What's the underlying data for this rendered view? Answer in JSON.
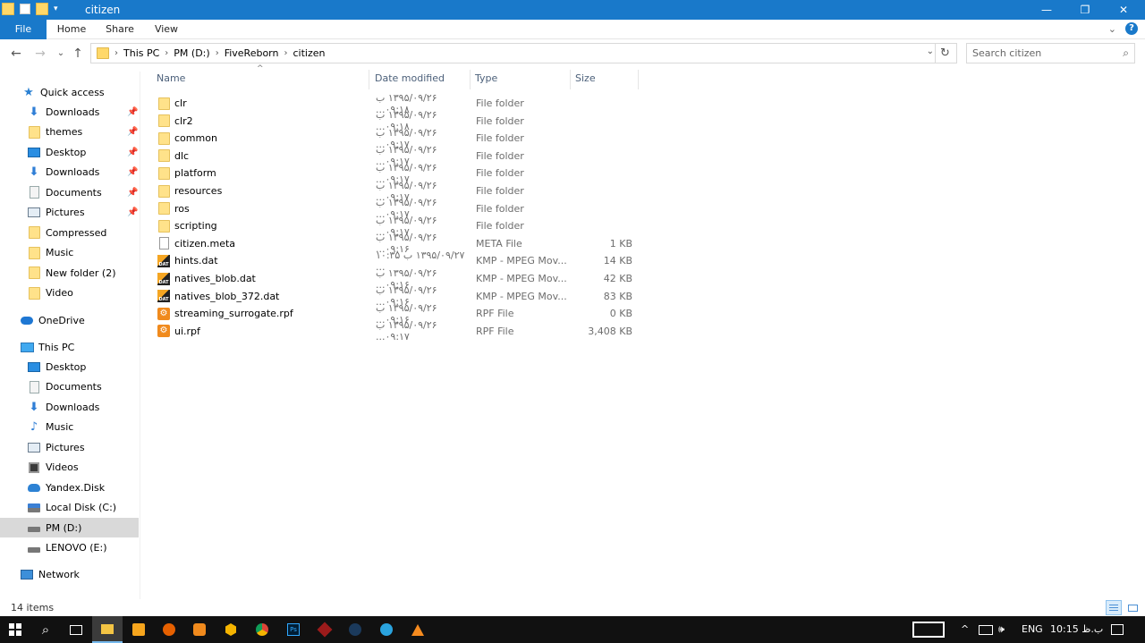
{
  "window": {
    "title": "citizen",
    "controls": {
      "minimize": "—",
      "restore": "❐",
      "close": "✕"
    }
  },
  "ribbon": {
    "tabs": [
      "File",
      "Home",
      "Share",
      "View"
    ],
    "help": "?",
    "expand": "⌄"
  },
  "navigation": {
    "back": "←",
    "forward": "→",
    "recent": "⌄",
    "up": "↑",
    "breadcrumbs": [
      "This PC",
      "PM (D:)",
      "FiveReborn",
      "citizen"
    ],
    "refresh": "↻",
    "dropdown": "⌄",
    "separator": "›"
  },
  "search": {
    "placeholder": "Search citizen"
  },
  "sidebar": {
    "quick_access": "Quick access",
    "quick_items": [
      {
        "label": "Downloads",
        "icon": "downloads-icon",
        "pinned": true
      },
      {
        "label": "themes",
        "icon": "folder-icon",
        "pinned": true
      },
      {
        "label": "Desktop",
        "icon": "desktop-icon",
        "pinned": true
      },
      {
        "label": "Downloads",
        "icon": "downloads-icon",
        "pinned": true
      },
      {
        "label": "Documents",
        "icon": "documents-icon",
        "pinned": true
      },
      {
        "label": "Pictures",
        "icon": "pictures-icon",
        "pinned": true
      },
      {
        "label": "Compressed",
        "icon": "folder-icon",
        "pinned": false
      },
      {
        "label": "Music",
        "icon": "folder-icon",
        "pinned": false
      },
      {
        "label": "New folder (2)",
        "icon": "folder-icon",
        "pinned": false
      },
      {
        "label": "Video",
        "icon": "folder-icon",
        "pinned": false
      }
    ],
    "onedrive": "OneDrive",
    "this_pc": "This PC",
    "pc_items": [
      {
        "label": "Desktop",
        "icon": "desktop-icon"
      },
      {
        "label": "Documents",
        "icon": "documents-icon"
      },
      {
        "label": "Downloads",
        "icon": "downloads-icon"
      },
      {
        "label": "Music",
        "icon": "music-icon"
      },
      {
        "label": "Pictures",
        "icon": "pictures-icon"
      },
      {
        "label": "Videos",
        "icon": "videos-icon"
      },
      {
        "label": "Yandex.Disk",
        "icon": "yandex-disk-icon"
      },
      {
        "label": "Local Disk (C:)",
        "icon": "local-disk-icon"
      },
      {
        "label": "PM (D:)",
        "icon": "drive-icon",
        "selected": true
      },
      {
        "label": "LENOVO (E:)",
        "icon": "drive-icon"
      }
    ],
    "network": "Network",
    "pin_glyph": "📌"
  },
  "columns": {
    "name": "Name",
    "date": "Date modified",
    "type": "Type",
    "size": "Size",
    "sort_glyph": "^"
  },
  "files": [
    {
      "name": "clr",
      "date": "۱۳۹۵/۰۹/۲۶ ب ۰۹:۱۸...",
      "type": "File folder",
      "size": "",
      "icon": "folder"
    },
    {
      "name": "clr2",
      "date": "۱۳۹۵/۰۹/۲۶ ب ۰۹:۱۸...",
      "type": "File folder",
      "size": "",
      "icon": "folder"
    },
    {
      "name": "common",
      "date": "۱۳۹۵/۰۹/۲۶ ب ۰۹:۱۷...",
      "type": "File folder",
      "size": "",
      "icon": "folder"
    },
    {
      "name": "dlc",
      "date": "۱۳۹۵/۰۹/۲۶ ب ۰۹:۱۷...",
      "type": "File folder",
      "size": "",
      "icon": "folder"
    },
    {
      "name": "platform",
      "date": "۱۳۹۵/۰۹/۲۶ ب ۰۹:۱۷...",
      "type": "File folder",
      "size": "",
      "icon": "folder"
    },
    {
      "name": "resources",
      "date": "۱۳۹۵/۰۹/۲۶ ب ۰۹:۱۷...",
      "type": "File folder",
      "size": "",
      "icon": "folder"
    },
    {
      "name": "ros",
      "date": "۱۳۹۵/۰۹/۲۶ ب ۰۹:۱۷...",
      "type": "File folder",
      "size": "",
      "icon": "folder"
    },
    {
      "name": "scripting",
      "date": "۱۳۹۵/۰۹/۲۶ ب ۰۹:۱۷...",
      "type": "File folder",
      "size": "",
      "icon": "folder"
    },
    {
      "name": "citizen.meta",
      "date": "۱۳۹۵/۰۹/۲۶ ب ۰۹:۱۶...",
      "type": "META File",
      "size": "1 KB",
      "icon": "meta"
    },
    {
      "name": "hints.dat",
      "date": "۱۳۹۵/۰۹/۲۷ ب ۱۰:۳۵ ...",
      "type": "KMP - MPEG Mov...",
      "size": "14 KB",
      "icon": "dat"
    },
    {
      "name": "natives_blob.dat",
      "date": "۱۳۹۵/۰۹/۲۶ ب ۰۹:۱۶...",
      "type": "KMP - MPEG Mov...",
      "size": "42 KB",
      "icon": "dat"
    },
    {
      "name": "natives_blob_372.dat",
      "date": "۱۳۹۵/۰۹/۲۶ ب ۰۹:۱۶...",
      "type": "KMP - MPEG Mov...",
      "size": "83 KB",
      "icon": "dat"
    },
    {
      "name": "streaming_surrogate.rpf",
      "date": "۱۳۹۵/۰۹/۲۶ ب ۰۹:۱۶...",
      "type": "RPF File",
      "size": "0 KB",
      "icon": "rpf"
    },
    {
      "name": "ui.rpf",
      "date": "۱۳۹۵/۰۹/۲۶ ب ۰۹:۱۷...",
      "type": "RPF File",
      "size": "3,408 KB",
      "icon": "rpf"
    }
  ],
  "status": {
    "count": "14 items"
  },
  "taskbar": {
    "language": "ENG",
    "clock": "10:15 ب.ظ",
    "tray_glyphs": {
      "chevron": "^",
      "volume": "🕪"
    }
  },
  "colors": {
    "accent": "#1979ca",
    "selected": "#d9d9d9",
    "header_text": "#4c607a",
    "taskbar": "#111111"
  }
}
